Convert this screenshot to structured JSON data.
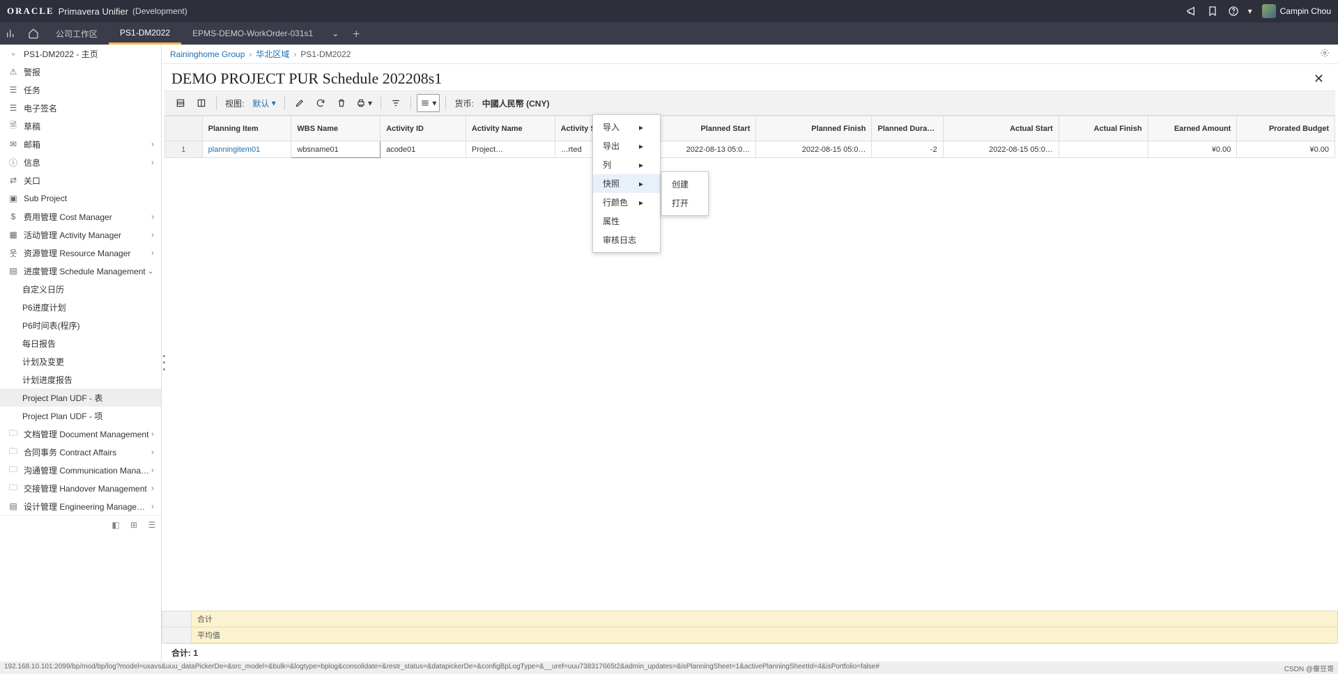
{
  "brand": {
    "name": "ORACLE",
    "product": "Primavera Unifier",
    "env": "(Development)",
    "user": "Campin Chou"
  },
  "tabs": {
    "t1": "公司工作区",
    "t2": "PS1-DM2022",
    "t3": "EPMS-DEMO-WorkOrder-031s1"
  },
  "sidebar": {
    "i0": "PS1-DM2022 - 主页",
    "i1": "警报",
    "i2": "任务",
    "i3": "电子签名",
    "i4": "草稿",
    "i5": "邮箱",
    "i6": "信息",
    "i7": "关口",
    "i8": "Sub Project",
    "i9": "费用管理 Cost Manager",
    "i10": "活动管理 Activity Manager",
    "i11": "资源管理 Resource Manager",
    "i12": "进度管理 Schedule Management",
    "s1": "自定义日历",
    "s2": "P6进度计划",
    "s3": "P6时间表(程序)",
    "s4": "每日报告",
    "s5": "计划及变更",
    "s6": "计划进度报告",
    "s7": "Project Plan UDF - 表",
    "s8": "Project Plan UDF - 项",
    "i13": "文档管理 Document Management",
    "i14": "合同事务 Contract Affairs",
    "i15": "沟通管理 Communication Management",
    "i16": "交接管理 Handover Management",
    "i17": "设计管理 Engineering Management"
  },
  "breadcrumb": {
    "a": "Raininghome Group",
    "b": "华北区域",
    "c": "PS1-DM2022"
  },
  "page": {
    "title": "DEMO PROJECT PUR Schedule 202208s1"
  },
  "toolbar": {
    "view_label": "视图:",
    "view_value": "默认",
    "currency_label": "货币:",
    "currency_value": "中國人民幣 (CNY)"
  },
  "menu": {
    "m1": "导入",
    "m2": "导出",
    "m3": "列",
    "m4": "快照",
    "m5": "行颜色",
    "m6": "属性",
    "m7": "审核日志",
    "sub1": "创建",
    "sub2": "打开"
  },
  "table": {
    "h_rn": "",
    "h_pi": "Planning Item",
    "h_wbs": "WBS Name",
    "h_aid": "Activity ID",
    "h_an": "Activity Name",
    "h_as": "Activity Status",
    "h_ps": "Planned Start",
    "h_pf": "Planned Finish",
    "h_pd": "Planned Duration",
    "h_ast": "Actual Start",
    "h_af": "Actual Finish",
    "h_ea": "Earned Amount",
    "h_pb": "Prorated Budget",
    "r1": {
      "n": "1",
      "pi": "planningitem01",
      "wbs": "wbsname01",
      "aid": "acode01",
      "an": "Project…",
      "as": "…rted",
      "ps": "2022-08-13 05:0…",
      "pf": "2022-08-15 05:0…",
      "pd": "-2",
      "ast": "2022-08-15 05:0…",
      "af": "",
      "ea": "¥0.00",
      "pb": "¥0.00"
    },
    "f1": "合计",
    "f2": "平均值"
  },
  "totals": {
    "label": "合计:",
    "value": "1"
  },
  "status": {
    "url": "192.168.10.101:2099/bp/mod/bp/log?model=uxavs&uuu_dataPickerDe=&src_model=&bulk=&logtype=bplog&consolidate=&restr_status=&datapickerDe=&configBpLogType=&__uref=uuu738317665t2&admin_updates=&isPlanningSheet=1&activePlanningSheetId=4&isPortfolio=false#",
    "right": "CSDN @蚕豆哥"
  }
}
